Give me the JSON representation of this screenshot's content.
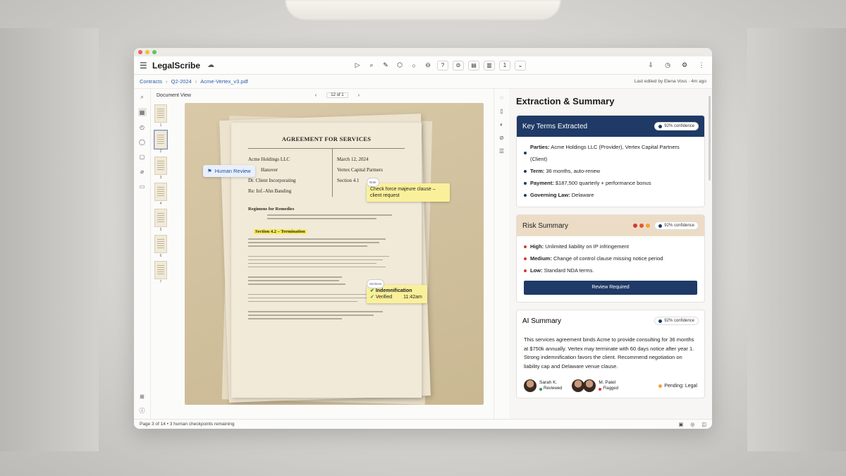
{
  "app": {
    "name": "LegalScribe"
  },
  "breadcrumb": [
    "Contracts",
    "Q2-2024",
    "Acme-Vertex_v3.pdf"
  ],
  "last_edited": "Last edited by Elena Voss · 4m ago",
  "toolbar": {
    "page_num": "1"
  },
  "document": {
    "view_label": "Document View",
    "page_indicator": "12 of 1",
    "thumb_numbers": [
      "1",
      "2",
      "3",
      "4",
      "5",
      "6",
      "7"
    ],
    "title": "AGREEMENT FOR SERVICES",
    "party_left": [
      "Acme Holdings LLC",
      "Hanover",
      "Dr. Client Incorporating",
      "Re: Inf.-Ahn Banding"
    ],
    "party_right": [
      "March 12, 2024",
      "Vertex Capital Partners",
      "Section 4.1"
    ],
    "section_heading": "Regimens for Remedies",
    "highlight_clause": "Section 4.2 – Termination",
    "human_review_label": "Human Review",
    "note1": {
      "tag": "Note",
      "text": "Check force majeure clause – client request"
    },
    "note2": {
      "tag": "Sections",
      "title": "Indemnification",
      "verified": "Verified",
      "time": "11:42am"
    }
  },
  "panel": {
    "title": "Extraction & Summary",
    "key_terms": {
      "title": "Key Terms Extracted",
      "confidence": "92% confidence",
      "items": [
        {
          "label": "Parties:",
          "text": "Acme Holdings LLC (Provider), Vertex Capital Partners (Client)"
        },
        {
          "label": "Term:",
          "text": "36 months, auto-renew"
        },
        {
          "label": "Payment:",
          "text": "$187,500 quarterly + performance bonus"
        },
        {
          "label": "Governing Law:",
          "text": "Delaware"
        }
      ]
    },
    "risk": {
      "title": "Risk Summary",
      "confidence": "92% confidence",
      "items": [
        {
          "label": "High:",
          "text": "Unlimited liability on IP infringement",
          "color": "#d23b2f"
        },
        {
          "label": "Medium:",
          "text": "Change of control clause missing notice period",
          "color": "#d23b2f"
        },
        {
          "label": "Low:",
          "text": "Standard NDA terms.",
          "color": "#d23b2f"
        }
      ],
      "button": "Review Required"
    },
    "ai_summary": {
      "title": "AI Summary",
      "confidence": "92% confidence",
      "text": "This services agreement binds Acme to provide consulting for 36 months at $750k annually. Vertex may terminate with 60 days notice after year 1. Strong indemnification favors the client. Recommend negotiation on liability cap and Delaware venue clause.",
      "people": [
        {
          "name": "Sarah K.",
          "status": "Reviewed",
          "color": "#2e9b4a"
        },
        {
          "name": "M. Patel",
          "status": "Flagged",
          "color": "#d23b2f"
        }
      ],
      "pending": "Pending: Legal"
    }
  },
  "status": {
    "text": "Page 3 of 14 • 3 human checkpoints remaining"
  },
  "colors": {
    "navy": "#1f3a66",
    "accent_blue": "#2b5da8",
    "highlight": "#f7ea5a",
    "note": "#fbf09a"
  }
}
